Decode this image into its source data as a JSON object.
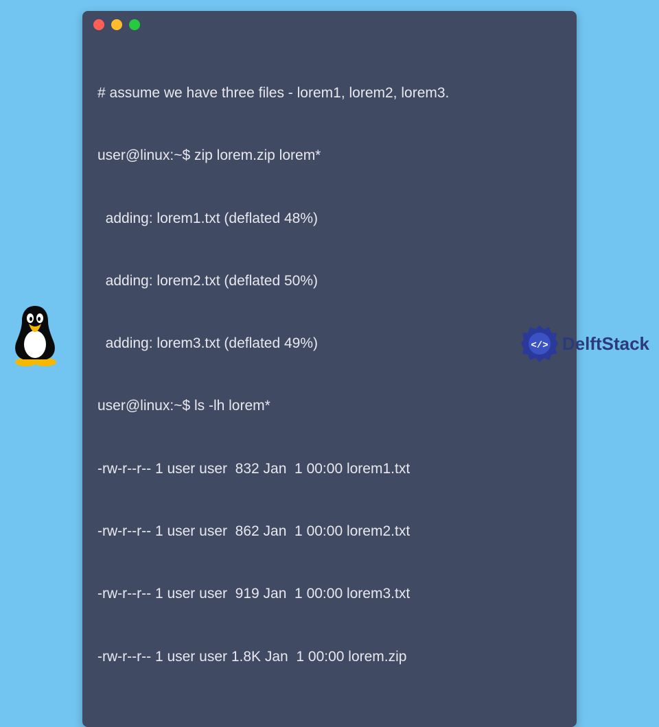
{
  "terminal": {
    "lines": [
      "# assume we have three files - lorem1, lorem2, lorem3.",
      "user@linux:~$ zip lorem.zip lorem*",
      "  adding: lorem1.txt (deflated 48%)",
      "  adding: lorem2.txt (deflated 50%)",
      "  adding: lorem3.txt (deflated 49%)",
      "user@linux:~$ ls -lh lorem*",
      "-rw-r--r-- 1 user user  832 Jan  1 00:00 lorem1.txt",
      "-rw-r--r-- 1 user user  862 Jan  1 00:00 lorem2.txt",
      "-rw-r--r-- 1 user user  919 Jan  1 00:00 lorem3.txt",
      "-rw-r--r-- 1 user user 1.8K Jan  1 00:00 lorem.zip"
    ]
  },
  "window_controls": {
    "red": "close",
    "yellow": "minimize",
    "green": "maximize"
  },
  "brand": {
    "name": "DelftStack"
  },
  "mascot": {
    "name": "tux"
  }
}
